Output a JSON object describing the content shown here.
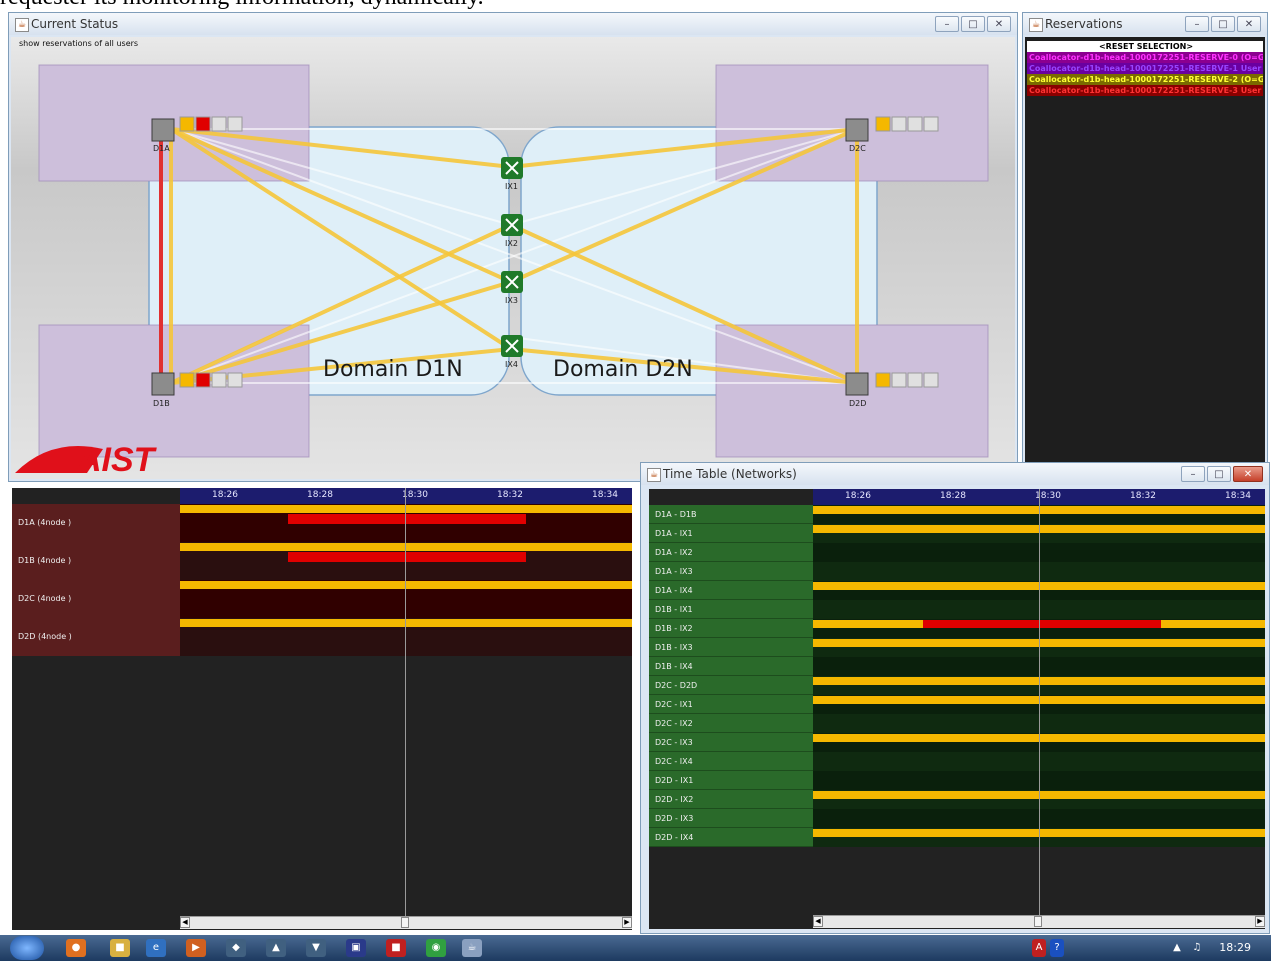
{
  "doc_text": "requester its monitoring information, dynamically.",
  "status_window": {
    "title": "Current Status",
    "subtitle": "show reservations of all users",
    "domains": [
      "Domain D1N",
      "Domain D2N"
    ],
    "nodes": [
      "D1A",
      "D1B",
      "D2C",
      "D2D"
    ],
    "switches": [
      "IX1",
      "IX2",
      "IX3",
      "IX4"
    ],
    "logo": "AIST"
  },
  "reservations_window": {
    "title": "Reservations",
    "reset": "<RESET SELECTION>",
    "items": [
      {
        "text": "Coallocator-d1b-head-1000172251-RESERVE-0 (O=Gr",
        "color": "#ff00ff"
      },
      {
        "text": "Coallocator-d1b-head-1000172251-RESERVE-1 User",
        "color": "#8800cc"
      },
      {
        "text": "Coallocator-d1b-head-1000172251-RESERVE-2 (O=Gr",
        "color": "#ffff00"
      },
      {
        "text": "Coallocator-d1b-head-1000172251-RESERVE-3 User",
        "color": "#dd0000"
      }
    ]
  },
  "node_timetable": {
    "ticks": [
      "18:26",
      "18:28",
      "18:30",
      "18:32",
      "18:34"
    ],
    "rows": [
      "D1A (4node )",
      "D1B (4node )",
      "D2C (4node )",
      "D2D (4node )"
    ],
    "reserved_rows": [
      0,
      1
    ]
  },
  "network_timetable": {
    "title": "Time Table (Networks)",
    "ticks": [
      "18:26",
      "18:28",
      "18:30",
      "18:32",
      "18:34"
    ],
    "rows": [
      "D1A - D1B",
      "D1A - IX1",
      "D1A - IX2",
      "D1A - IX3",
      "D1A - IX4",
      "D1B - IX1",
      "D1B - IX2",
      "D1B - IX3",
      "D1B - IX4",
      "D2C - D2D",
      "D2C - IX1",
      "D2C - IX2",
      "D2C - IX3",
      "D2C - IX4",
      "D2D - IX1",
      "D2D - IX2",
      "D2D - IX3",
      "D2D - IX4"
    ],
    "active_rows": [
      0,
      1,
      4,
      6,
      7,
      9,
      10,
      12,
      15,
      17
    ],
    "reserved_row": 6
  },
  "taskbar": {
    "clock": "18:29"
  }
}
